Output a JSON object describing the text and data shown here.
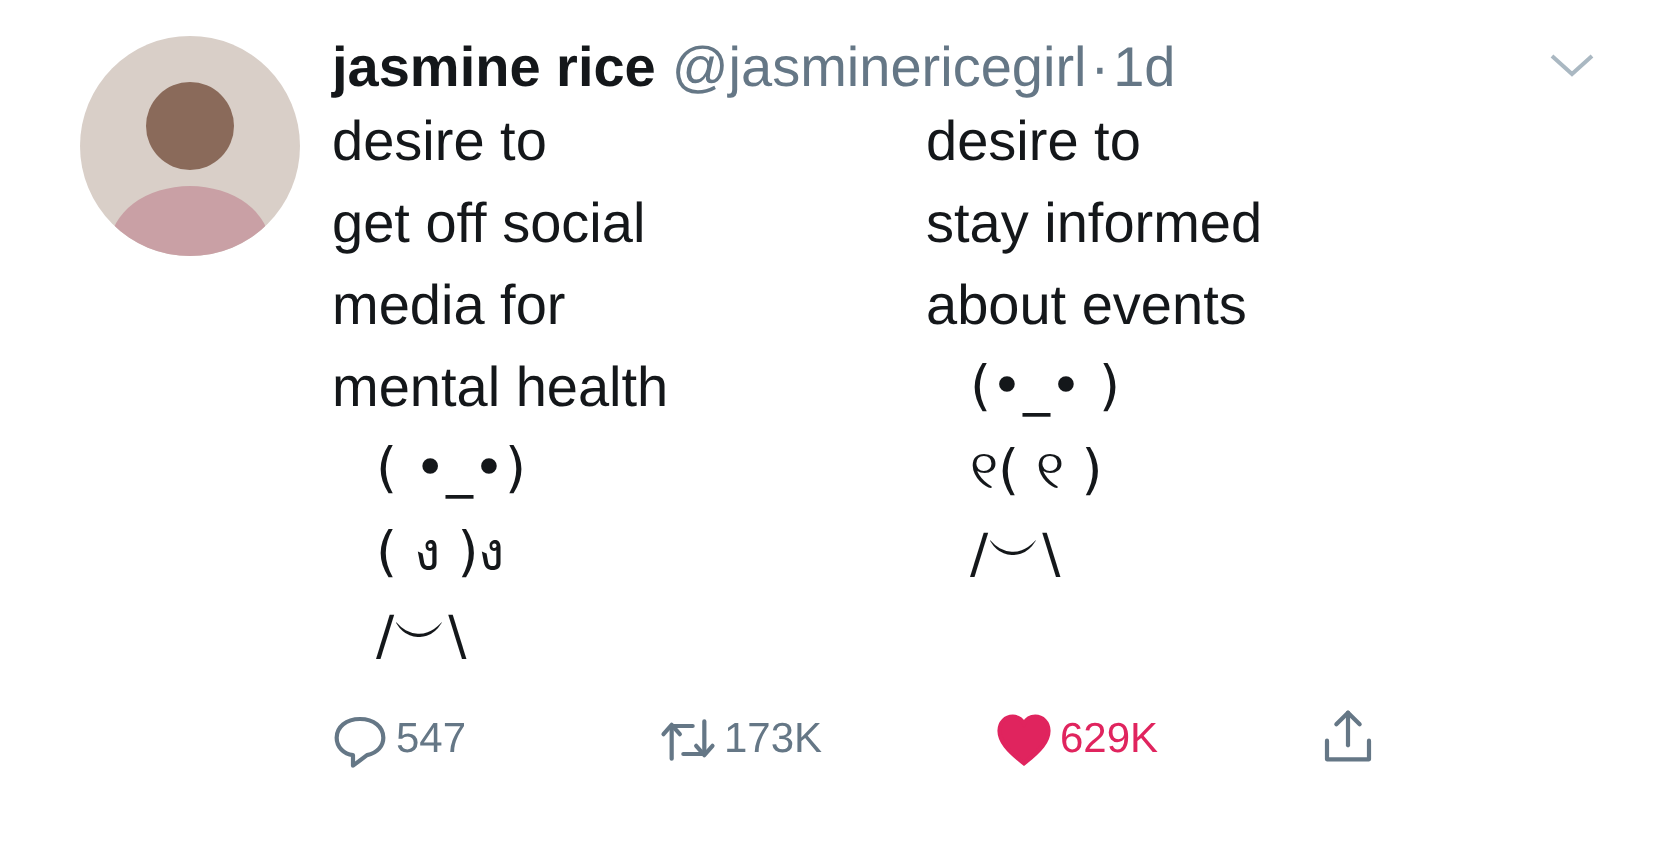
{
  "tweet": {
    "name": "jasmine rice",
    "handle": "@jasminericegirl",
    "separator": "·",
    "time": "1d",
    "columns": [
      {
        "text_lines": [
          "desire to",
          "get off social",
          "media for",
          "mental health"
        ],
        "art_lines": [
          "( •_•)",
          "( ง )ง",
          "/︶\\"
        ]
      },
      {
        "text_lines": [
          "desire to",
          "stay informed",
          "about events"
        ],
        "art_lines": [
          "(•_• )",
          "୧( ୧ )",
          "/︶\\"
        ]
      }
    ],
    "actions": [
      {
        "kind": "reply",
        "count": "547"
      },
      {
        "kind": "retweet",
        "count": "173K",
        "selected": false
      },
      {
        "kind": "like",
        "count": "629K",
        "selected": true
      },
      {
        "kind": "share"
      }
    ]
  }
}
